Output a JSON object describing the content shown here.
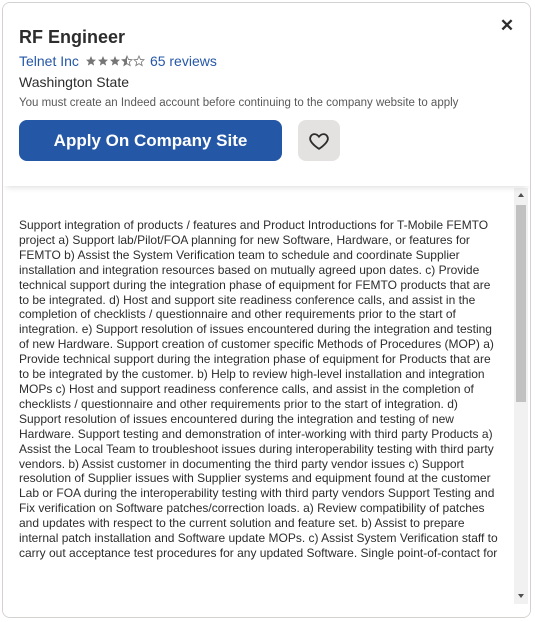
{
  "job": {
    "title": "RF Engineer",
    "company": "Telnet Inc",
    "rating": 3.5,
    "reviews_label": "65 reviews",
    "location": "Washington State",
    "notice": "You must create an Indeed account before continuing to the company website to apply"
  },
  "actions": {
    "apply_label": "Apply On Company Site",
    "close_icon": "close-icon",
    "save_icon": "heart-icon"
  },
  "description": "Support integration of products / features and Product Introductions for T-Mobile FEMTO project a) Support lab/Pilot/FOA planning for new Software, Hardware, or features for FEMTO b) Assist the System Verification team to schedule and coordinate Supplier installation and integration resources based on mutually agreed upon dates. c) Provide technical support during the integration phase of equipment for FEMTO products that are to be integrated. d) Host and support site readiness conference calls, and assist in the completion of checklists / questionnaire and other requirements prior to the start of integration. e) Support resolution of issues encountered during the integration and testing of new Hardware. Support creation of customer specific Methods of Procedures (MOP) a) Provide technical support during the integration phase of equipment for Products that are to be integrated by the customer. b) Help to review high-level installation and integration MOPs c) Host and support readiness conference calls, and assist in the completion of checklists / questionnaire and other requirements prior to the start of integration. d) Support resolution of issues encountered during the integration and testing of new Hardware. Support testing and demonstration of inter-working with third party Products a) Assist the Local Team to troubleshoot issues during interoperability testing with third party vendors. b) Assist customer in documenting the third party vendor issues c) Support resolution of Supplier issues with Supplier systems and equipment found at the customer Lab or FOA during the interoperability testing with third party vendors Support Testing and Fix verification on Software patches/correction loads. a) Review compatibility of patches and updates with respect to the current solution and feature set. b) Assist to prepare internal patch installation and Software update MOPs. c) Assist System Verification staff to carry out acceptance test procedures for any updated Software. Single point-of-contact for",
  "colors": {
    "link": "#2557a7",
    "apply_bg": "#2557a7",
    "save_bg": "#e4e2e0",
    "star": "#767676"
  }
}
